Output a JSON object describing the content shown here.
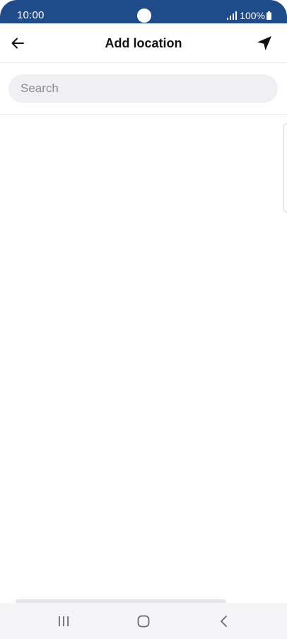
{
  "status_bar": {
    "time": "10:00",
    "battery": "100%",
    "background_color": "#1f4b8a",
    "icons": [
      "signal-icon",
      "battery-icon"
    ]
  },
  "header": {
    "title": "Add location",
    "left_icon": "back-arrow-icon",
    "right_icon": "navigation-arrow-icon"
  },
  "search": {
    "placeholder": "Search",
    "value": ""
  },
  "nav_bar": {
    "icons": [
      "recents-icon",
      "home-icon",
      "nav-back-icon"
    ]
  }
}
